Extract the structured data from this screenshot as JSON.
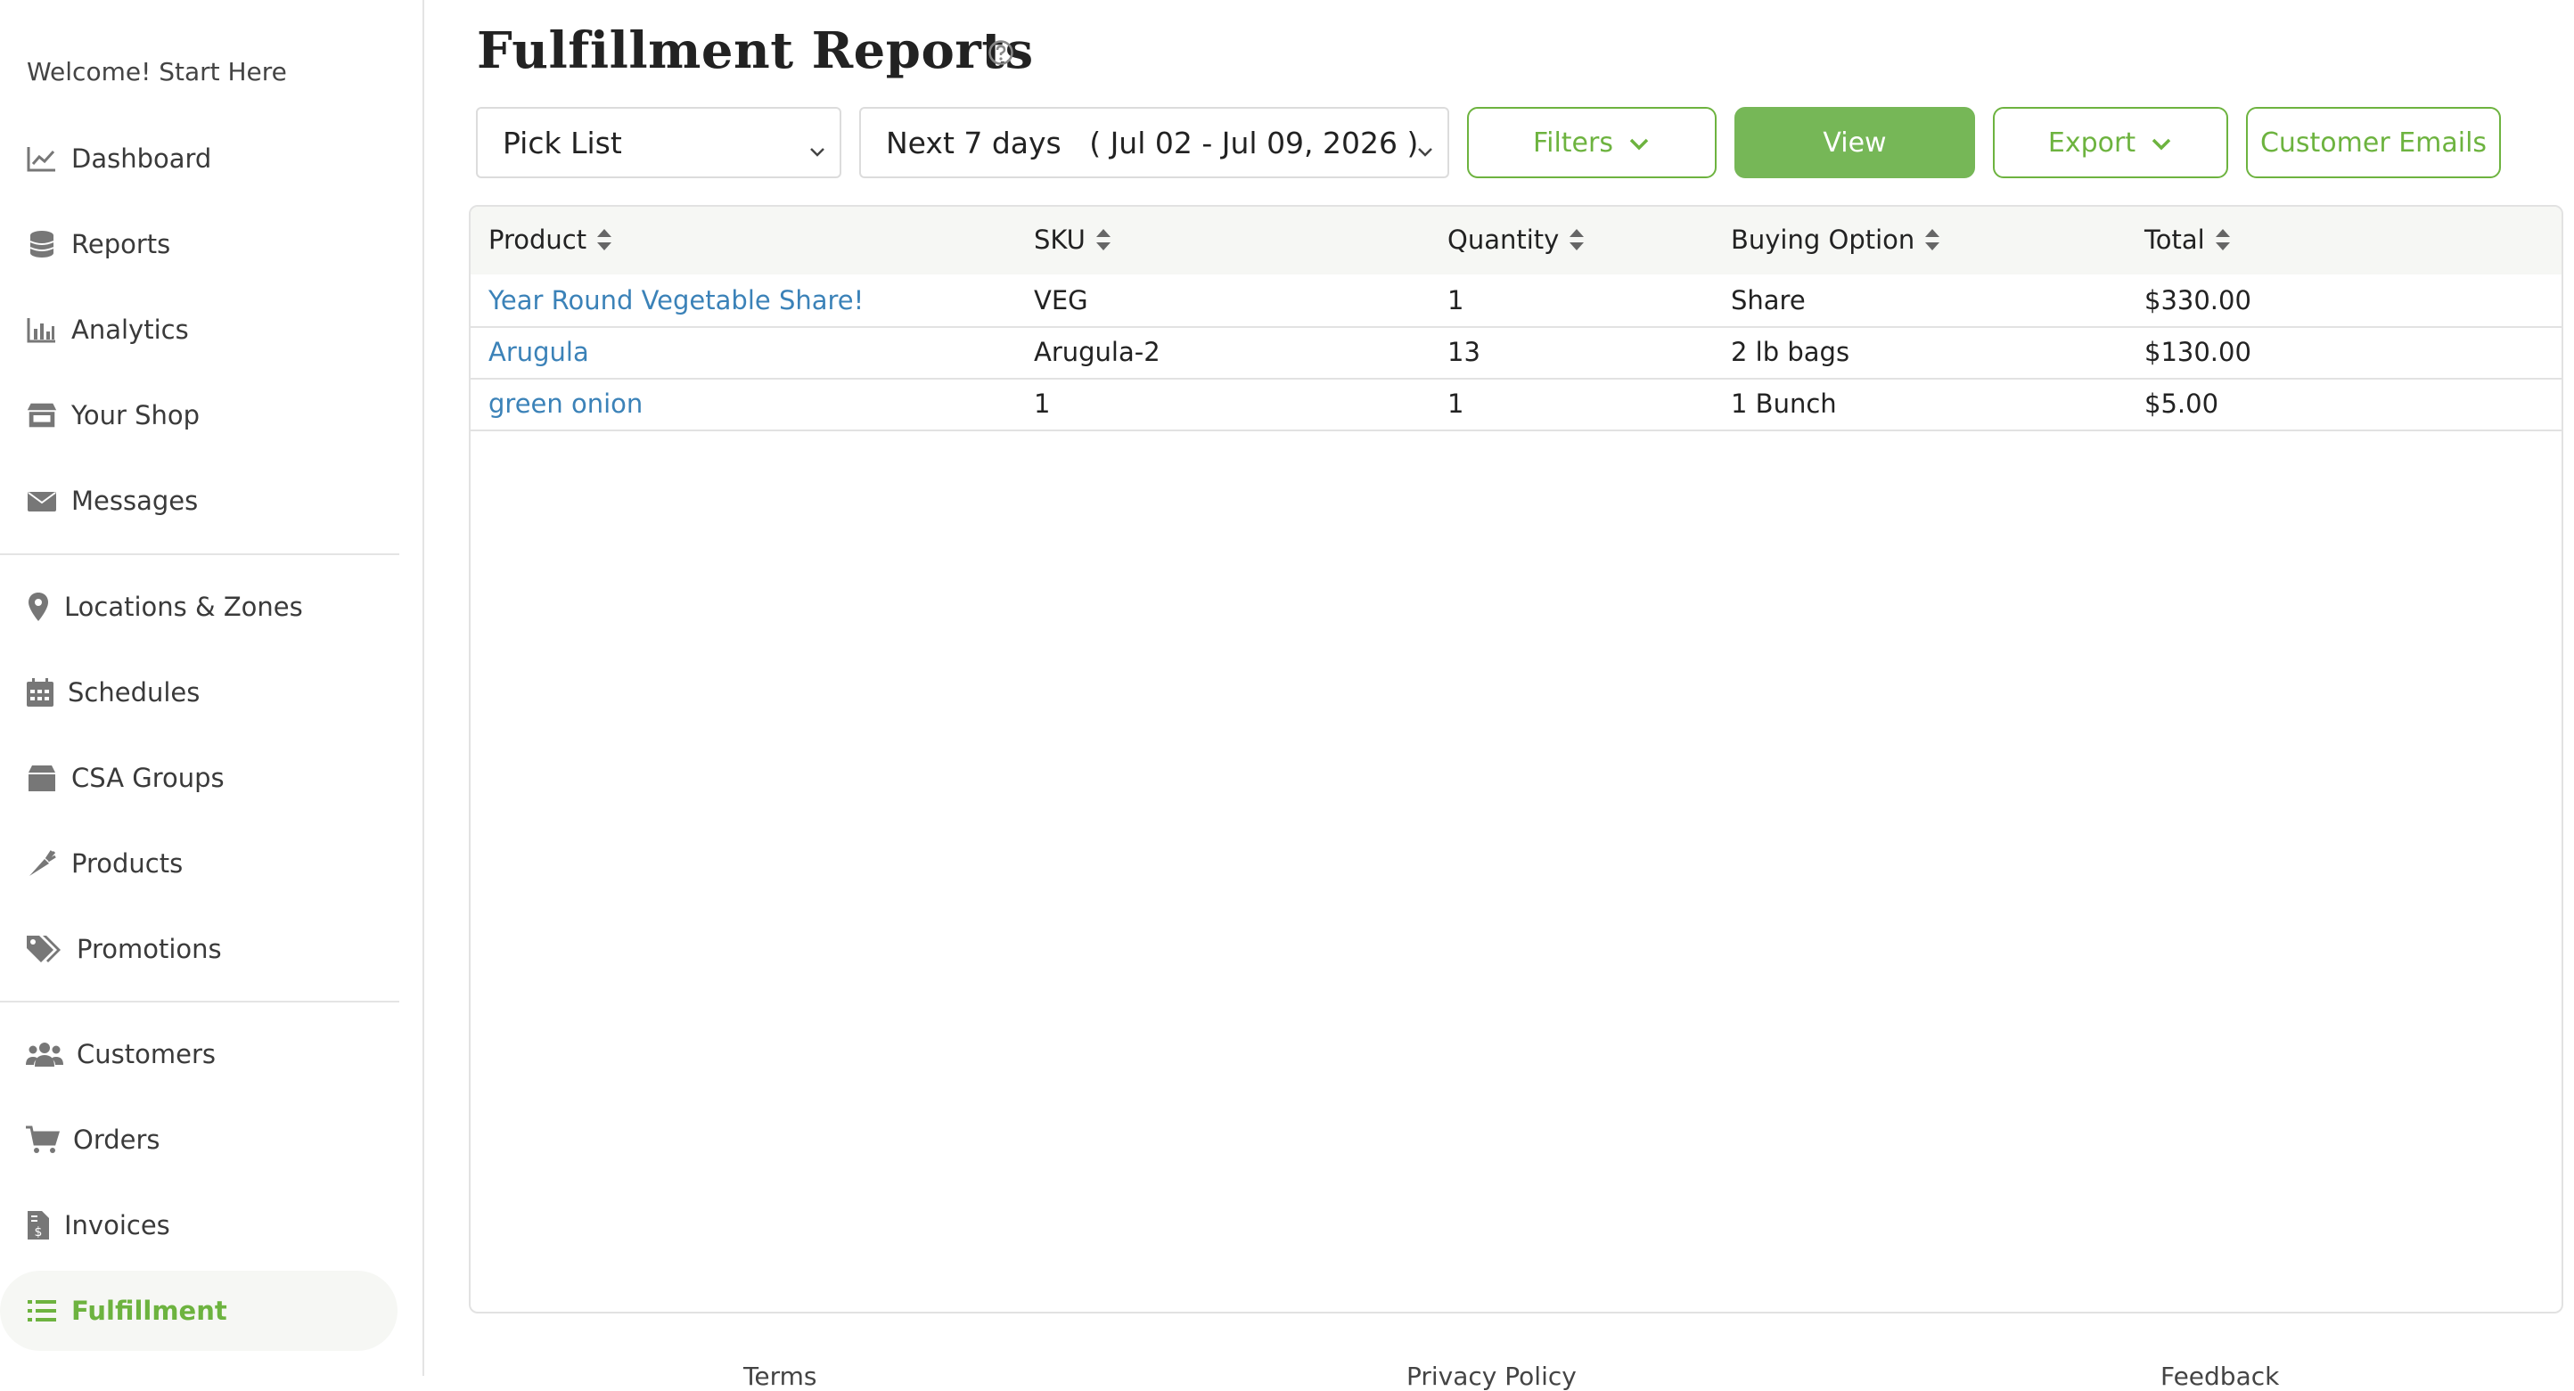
{
  "sidebar": {
    "welcome": "Welcome! Start Here",
    "items": [
      {
        "label": "Dashboard",
        "icon": "chart-line-icon"
      },
      {
        "label": "Reports",
        "icon": "coins-icon"
      },
      {
        "label": "Analytics",
        "icon": "bar-chart-icon"
      },
      {
        "label": "Your Shop",
        "icon": "store-icon"
      },
      {
        "label": "Messages",
        "icon": "envelope-icon"
      },
      {
        "label": "Locations & Zones",
        "icon": "map-pin-icon"
      },
      {
        "label": "Schedules",
        "icon": "calendar-icon"
      },
      {
        "label": "CSA Groups",
        "icon": "box-icon"
      },
      {
        "label": "Products",
        "icon": "carrot-icon"
      },
      {
        "label": "Promotions",
        "icon": "tags-icon"
      },
      {
        "label": "Customers",
        "icon": "users-icon"
      },
      {
        "label": "Orders",
        "icon": "cart-icon"
      },
      {
        "label": "Invoices",
        "icon": "invoice-icon"
      },
      {
        "label": "Fulfillment",
        "icon": "list-icon",
        "active": true
      }
    ]
  },
  "header": {
    "title": "Fulfillment Reports"
  },
  "toolbar": {
    "report_type": "Pick List",
    "date_range": "Next 7 days   ( Jul 02 - Jul 09, 2026 )",
    "filters_label": "Filters",
    "view_label": "View",
    "export_label": "Export",
    "customer_emails_label": "Customer Emails"
  },
  "table": {
    "columns": [
      "Product",
      "SKU",
      "Quantity",
      "Buying Option",
      "Total"
    ],
    "rows": [
      {
        "product": "Year Round Vegetable Share!",
        "sku": "VEG",
        "quantity": "1",
        "buying_option": "Share",
        "total": "$330.00"
      },
      {
        "product": "Arugula",
        "sku": "Arugula-2",
        "quantity": "13",
        "buying_option": "2 lb bags",
        "total": "$130.00"
      },
      {
        "product": "green onion",
        "sku": "1",
        "quantity": "1",
        "buying_option": "1 Bunch",
        "total": "$5.00"
      }
    ]
  },
  "footer": {
    "links": [
      "Terms",
      "Privacy Policy",
      "Feedback"
    ]
  },
  "colors": {
    "accent": "#6db33f",
    "button_fill": "#76b757",
    "link": "#3b82b8"
  }
}
